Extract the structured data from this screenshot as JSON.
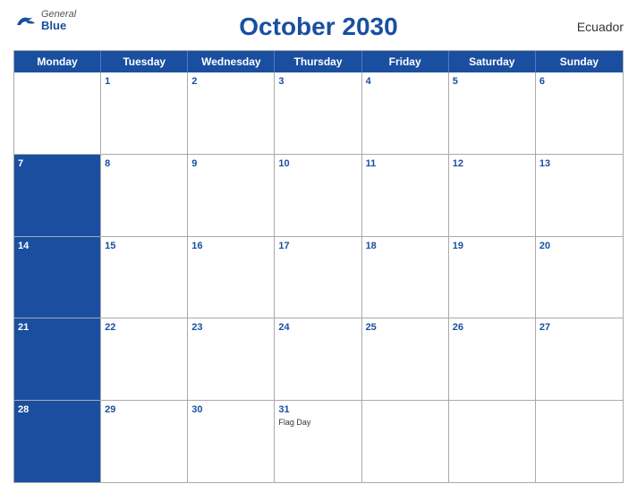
{
  "header": {
    "title": "October 2030",
    "country": "Ecuador",
    "logo": {
      "general": "General",
      "blue": "Blue"
    }
  },
  "days_of_week": [
    "Monday",
    "Tuesday",
    "Wednesday",
    "Thursday",
    "Friday",
    "Saturday",
    "Sunday"
  ],
  "weeks": [
    [
      {
        "num": "",
        "event": ""
      },
      {
        "num": "1",
        "event": ""
      },
      {
        "num": "2",
        "event": ""
      },
      {
        "num": "3",
        "event": ""
      },
      {
        "num": "4",
        "event": ""
      },
      {
        "num": "5",
        "event": ""
      },
      {
        "num": "6",
        "event": ""
      }
    ],
    [
      {
        "num": "7",
        "event": ""
      },
      {
        "num": "8",
        "event": ""
      },
      {
        "num": "9",
        "event": ""
      },
      {
        "num": "10",
        "event": ""
      },
      {
        "num": "11",
        "event": ""
      },
      {
        "num": "12",
        "event": ""
      },
      {
        "num": "13",
        "event": ""
      }
    ],
    [
      {
        "num": "14",
        "event": ""
      },
      {
        "num": "15",
        "event": ""
      },
      {
        "num": "16",
        "event": ""
      },
      {
        "num": "17",
        "event": ""
      },
      {
        "num": "18",
        "event": ""
      },
      {
        "num": "19",
        "event": ""
      },
      {
        "num": "20",
        "event": ""
      }
    ],
    [
      {
        "num": "21",
        "event": ""
      },
      {
        "num": "22",
        "event": ""
      },
      {
        "num": "23",
        "event": ""
      },
      {
        "num": "24",
        "event": ""
      },
      {
        "num": "25",
        "event": ""
      },
      {
        "num": "26",
        "event": ""
      },
      {
        "num": "27",
        "event": ""
      }
    ],
    [
      {
        "num": "28",
        "event": ""
      },
      {
        "num": "29",
        "event": ""
      },
      {
        "num": "30",
        "event": ""
      },
      {
        "num": "31",
        "event": "Flag Day"
      },
      {
        "num": "",
        "event": ""
      },
      {
        "num": "",
        "event": ""
      },
      {
        "num": "",
        "event": ""
      }
    ]
  ]
}
